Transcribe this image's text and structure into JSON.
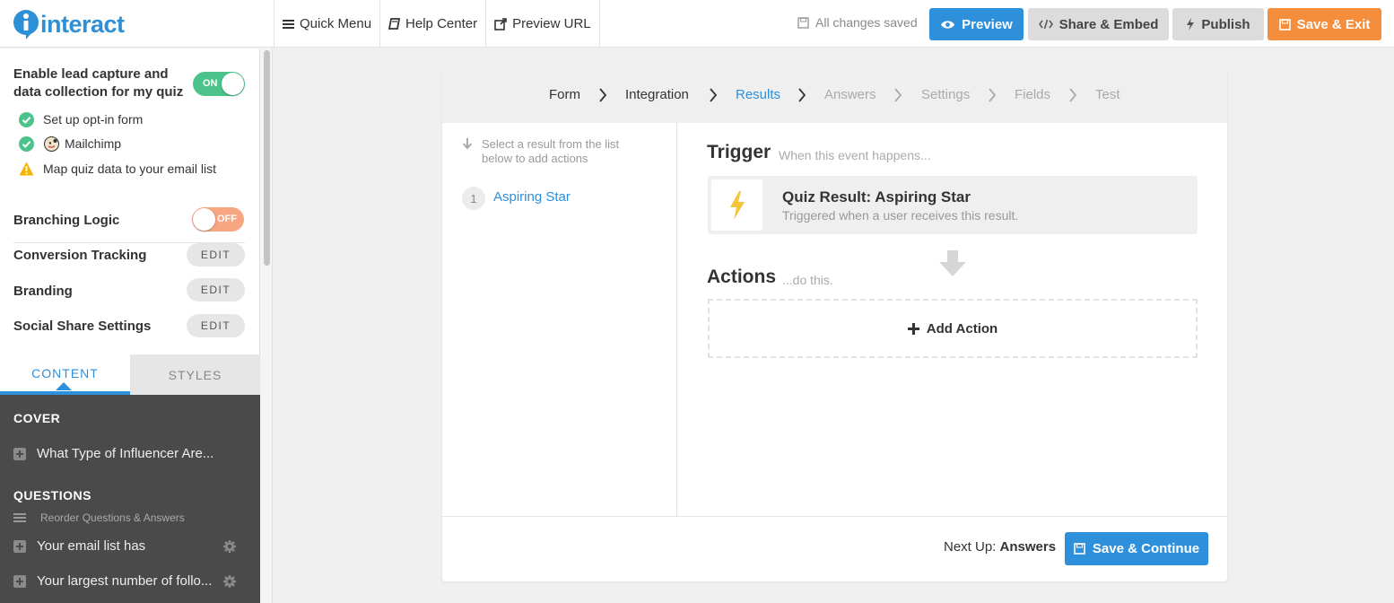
{
  "app": {
    "logo_text": "interact"
  },
  "topnav": {
    "quick_menu": "Quick Menu",
    "help_center": "Help Center",
    "preview_url": "Preview URL"
  },
  "toolbar": {
    "saved_status": "All changes saved",
    "preview_label": "Preview",
    "share_label": "Share & Embed",
    "publish_label": "Publish",
    "save_exit_label": "Save & Exit"
  },
  "sidebar": {
    "lead_capture_label": "Enable lead capture and data collection for my quiz",
    "lead_capture_toggle": "ON",
    "checklist": [
      {
        "label": "Set up opt-in form",
        "status": "done"
      },
      {
        "label": "Mailchimp",
        "status": "done"
      },
      {
        "label": "Map quiz data to your email list",
        "status": "warning"
      }
    ],
    "branching_label": "Branching Logic",
    "branching_toggle": "OFF",
    "settings": [
      {
        "label": "Conversion Tracking",
        "button": "EDIT"
      },
      {
        "label": "Branding",
        "button": "EDIT"
      },
      {
        "label": "Social Share Settings",
        "button": "EDIT"
      }
    ],
    "tabs": [
      {
        "label": "CONTENT",
        "active": true
      },
      {
        "label": "STYLES",
        "active": false
      }
    ],
    "cover_heading": "COVER",
    "cover_item": "What Type of Influencer Are...",
    "questions_heading": "QUESTIONS",
    "reorder_label": "Reorder Questions & Answers",
    "questions": [
      "Your email list has",
      "Your largest number of follo..."
    ]
  },
  "breadcrumb": [
    {
      "label": "Form",
      "state": "done"
    },
    {
      "label": "Integration",
      "state": "done"
    },
    {
      "label": "Results",
      "state": "active"
    },
    {
      "label": "Answers",
      "state": "pending"
    },
    {
      "label": "Settings",
      "state": "pending"
    },
    {
      "label": "Fields",
      "state": "pending"
    },
    {
      "label": "Test",
      "state": "pending"
    }
  ],
  "results": {
    "hint": "Select a result from the list below to add actions",
    "items": [
      {
        "number": "1",
        "name": "Aspiring Star"
      }
    ]
  },
  "trigger": {
    "heading": "Trigger",
    "subheading": "When this event happens...",
    "title": "Quiz Result: Aspiring Star",
    "description": "Triggered when a user receives this result."
  },
  "actions": {
    "heading": "Actions",
    "subheading": "...do this.",
    "add_label": "Add Action"
  },
  "footer": {
    "next_up_prefix": "Next Up:",
    "next_up_value": "Answers",
    "continue_label": "Save & Continue"
  },
  "colors": {
    "accent": "#2e8fdb",
    "orange": "#f58e3c",
    "success": "#4cc38a",
    "warning": "#f5b400",
    "toggle_off": "#f8a582"
  }
}
